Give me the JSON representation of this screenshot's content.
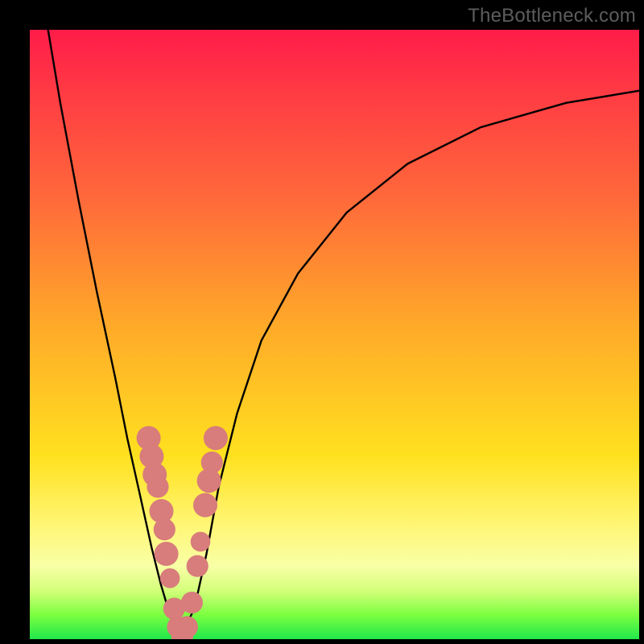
{
  "watermark": "TheBottleneck.com",
  "chart_data": {
    "type": "line",
    "title": "",
    "xlabel": "",
    "ylabel": "",
    "xlim": [
      0,
      100
    ],
    "ylim": [
      0,
      100
    ],
    "series": [
      {
        "name": "bottleneck-curve",
        "x": [
          3,
          5,
          8,
          11,
          14,
          16,
          18,
          20,
          21.5,
          23,
          24,
          25,
          27,
          29,
          31,
          34,
          38,
          44,
          52,
          62,
          74,
          88,
          100
        ],
        "y": [
          100,
          88,
          72,
          57,
          43,
          33,
          24,
          15,
          9,
          4,
          1,
          1,
          5,
          14,
          25,
          37,
          49,
          60,
          70,
          78,
          84,
          88,
          90
        ]
      }
    ],
    "markers": {
      "name": "highlight-dots",
      "color": "#d87c7c",
      "points": [
        {
          "x": 19.5,
          "y": 33,
          "r": 2.2
        },
        {
          "x": 20.0,
          "y": 30,
          "r": 2.2
        },
        {
          "x": 20.5,
          "y": 27,
          "r": 2.2
        },
        {
          "x": 21.0,
          "y": 25,
          "r": 2.0
        },
        {
          "x": 21.6,
          "y": 21,
          "r": 2.2
        },
        {
          "x": 22.1,
          "y": 18,
          "r": 2.0
        },
        {
          "x": 22.4,
          "y": 14,
          "r": 2.2
        },
        {
          "x": 23.0,
          "y": 10,
          "r": 1.8
        },
        {
          "x": 23.7,
          "y": 5,
          "r": 2.0
        },
        {
          "x": 24.3,
          "y": 2,
          "r": 2.0
        },
        {
          "x": 25.0,
          "y": 0.5,
          "r": 2.0
        },
        {
          "x": 25.8,
          "y": 2,
          "r": 2.0
        },
        {
          "x": 26.6,
          "y": 6,
          "r": 2.0
        },
        {
          "x": 27.5,
          "y": 12,
          "r": 2.0
        },
        {
          "x": 28.0,
          "y": 16,
          "r": 1.8
        },
        {
          "x": 28.8,
          "y": 22,
          "r": 2.2
        },
        {
          "x": 29.4,
          "y": 26,
          "r": 2.2
        },
        {
          "x": 29.9,
          "y": 29,
          "r": 2.0
        },
        {
          "x": 30.5,
          "y": 33,
          "r": 2.2
        }
      ]
    }
  }
}
